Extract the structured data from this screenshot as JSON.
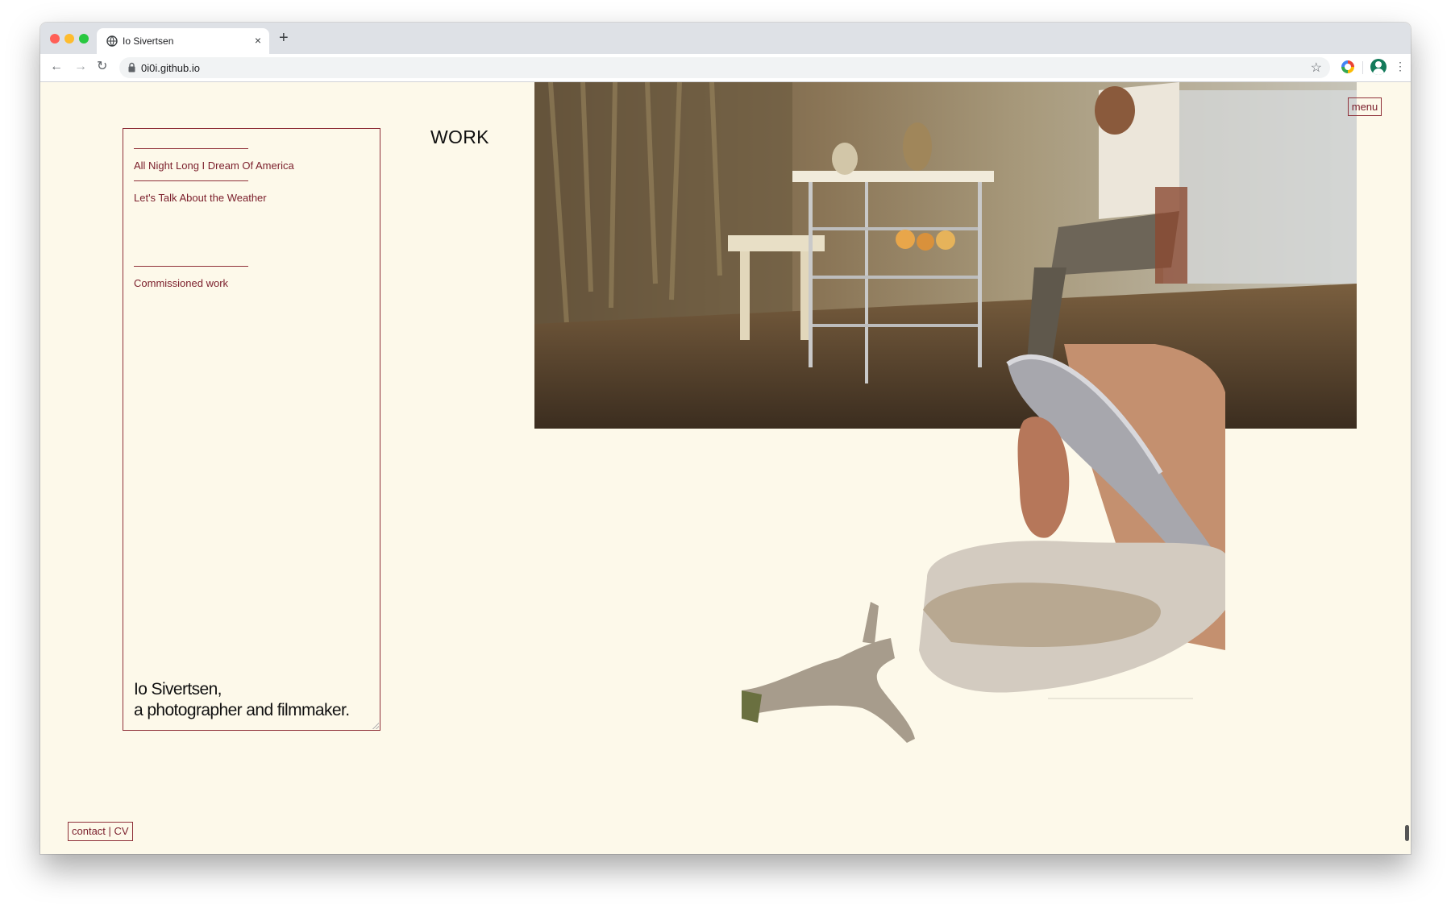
{
  "browser": {
    "tab_title": "Io Sivertsen",
    "tab_close": "×",
    "new_tab": "+",
    "back": "←",
    "forward": "→",
    "reload": "↻",
    "url": "0i0i.github.io",
    "star": "☆",
    "kebab": "⋮",
    "icons": [
      "globe-icon",
      "lock-icon",
      "star-icon",
      "extension-icon",
      "profile-icon",
      "more-icon"
    ]
  },
  "page": {
    "section_title": "WORK",
    "menu_label": "menu",
    "nav_links": [
      "All Night Long I Dream Of America",
      "Let's Talk About the Weather",
      "Commissioned work"
    ],
    "intro_line1": "Io Sivertsen,",
    "intro_line2": "a photographer and filmmaker.",
    "footer": {
      "contact": "contact",
      "divider": " | ",
      "cv": "CV"
    }
  },
  "colors": {
    "background": "#fdf9ea",
    "accent": "#7a1d2a",
    "border": "#8f3039",
    "text": "#111111"
  }
}
